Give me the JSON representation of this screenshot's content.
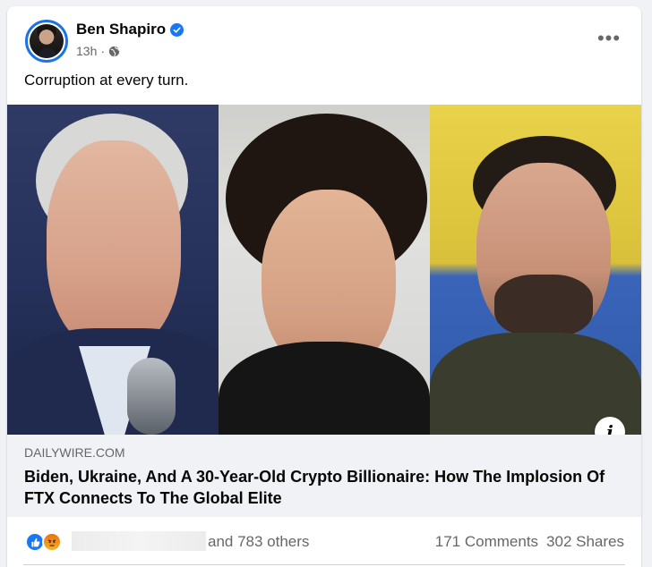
{
  "post": {
    "author": "Ben Shapiro",
    "time": "13h",
    "separator": "·",
    "text": "Corruption at every turn.",
    "more_label": "•••"
  },
  "link": {
    "domain": "DAILYWIRE.COM",
    "title": "Biden, Ukraine, And A 30-Year-Old Crypto Billionaire: How The Implosion Of FTX Connects To The Global Elite",
    "info_label": "i"
  },
  "engagement": {
    "reactions": [
      "like",
      "angry"
    ],
    "others_text": "and 783 others",
    "comments": "171 Comments",
    "shares": "302 Shares"
  },
  "icons": {
    "verified": "verified-badge-icon",
    "audience": "globe-icon",
    "more": "more-options-icon",
    "info": "info-icon"
  },
  "colors": {
    "accent": "#1877f2",
    "secondary_text": "#65676b",
    "link_meta_bg": "#f0f2f5"
  }
}
